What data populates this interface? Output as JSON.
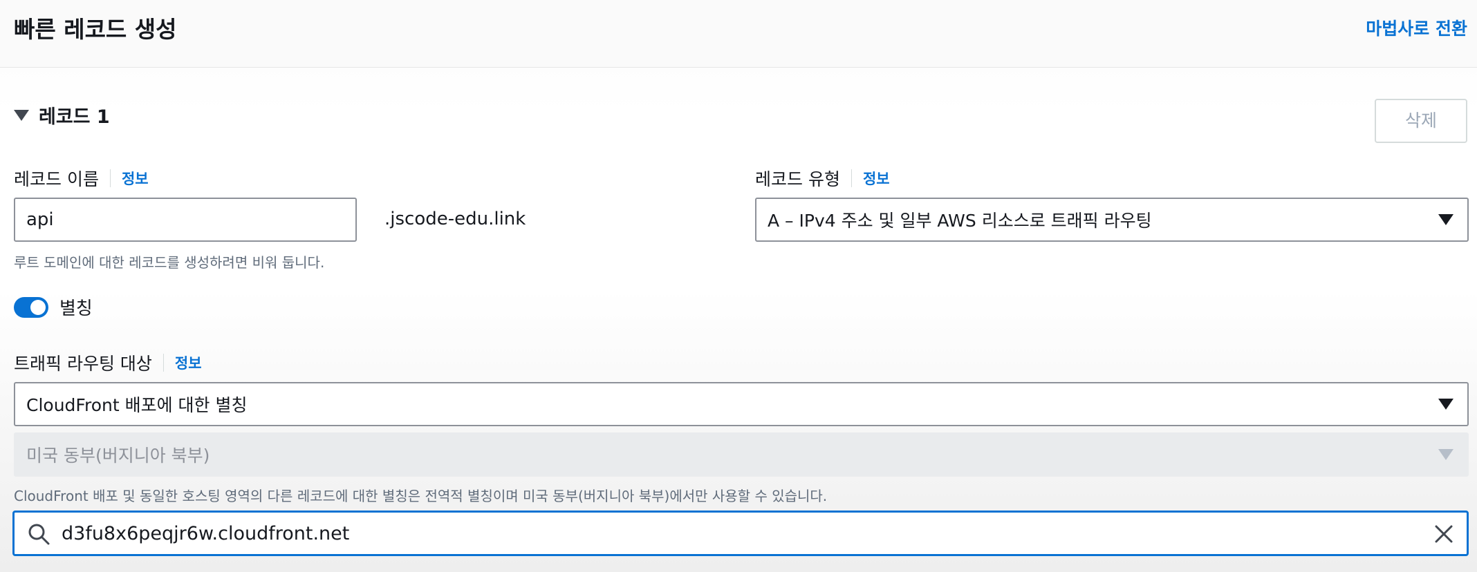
{
  "header": {
    "title": "빠른 레코드 생성",
    "wizard_link": "마법사로 전환"
  },
  "record": {
    "heading": "레코드 1",
    "delete_label": "삭제"
  },
  "record_name": {
    "label": "레코드 이름",
    "info": "정보",
    "value": "api",
    "suffix": ".jscode-edu.link",
    "hint": "루트 도메인에 대한 레코드를 생성하려면 비워 둡니다."
  },
  "record_type": {
    "label": "레코드 유형",
    "info": "정보",
    "value": "A – IPv4 주소 및 일부 AWS 리소스로 트래픽 라우팅"
  },
  "alias": {
    "label": "별칭",
    "enabled": true
  },
  "routing_target": {
    "label": "트래픽 라우팅 대상",
    "info": "정보",
    "endpoint_value": "CloudFront 배포에 대한 별칭",
    "region_value": "미국 동부(버지니아 북부)",
    "hint": "CloudFront 배포 및 동일한 호스팅 영역의 다른 레코드에 대한 별칭은 전역적 별칭이며 미국 동부(버지니아 북부)에서만 사용할 수 있습니다.",
    "search_value": "d3fu8x6peqjr6w.cloudfront.net"
  },
  "colors": {
    "accent": "#0972d3",
    "text": "#16191f",
    "hint": "#5f6b7a"
  },
  "icons": [
    "caret-down-icon",
    "dropdown-arrow-icon",
    "search-icon",
    "clear-icon"
  ]
}
